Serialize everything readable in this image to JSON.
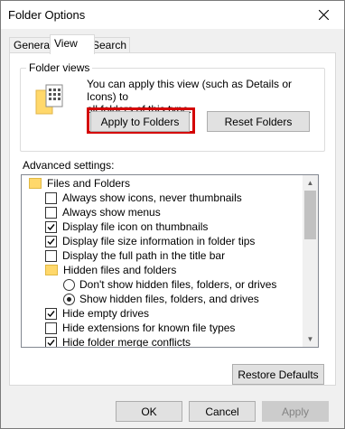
{
  "window": {
    "title": "Folder Options",
    "close_icon": "close-icon"
  },
  "tabs": [
    {
      "label": "General"
    },
    {
      "label": "View"
    },
    {
      "label": "Search"
    }
  ],
  "folder_views": {
    "legend": "Folder views",
    "description_line1": "You can apply this view (such as Details or Icons) to",
    "description_line2": "all folders of this type.",
    "apply_button": "Apply to Folders",
    "reset_button": "Reset Folders"
  },
  "advanced": {
    "label": "Advanced settings:",
    "items": [
      {
        "type": "folder",
        "label": "Files and Folders",
        "level": 0
      },
      {
        "type": "checkbox",
        "label": "Always show icons, never thumbnails",
        "checked": false,
        "level": 1
      },
      {
        "type": "checkbox",
        "label": "Always show menus",
        "checked": false,
        "level": 1
      },
      {
        "type": "checkbox",
        "label": "Display file icon on thumbnails",
        "checked": true,
        "level": 1
      },
      {
        "type": "checkbox",
        "label": "Display file size information in folder tips",
        "checked": true,
        "level": 1
      },
      {
        "type": "checkbox",
        "label": "Display the full path in the title bar",
        "checked": false,
        "level": 1
      },
      {
        "type": "folder",
        "label": "Hidden files and folders",
        "level": 1
      },
      {
        "type": "radio",
        "label": "Don't show hidden files, folders, or drives",
        "checked": false,
        "level": 2
      },
      {
        "type": "radio",
        "label": "Show hidden files, folders, and drives",
        "checked": true,
        "level": 2
      },
      {
        "type": "checkbox",
        "label": "Hide empty drives",
        "checked": true,
        "level": 1
      },
      {
        "type": "checkbox",
        "label": "Hide extensions for known file types",
        "checked": false,
        "level": 1
      },
      {
        "type": "checkbox",
        "label": "Hide folder merge conflicts",
        "checked": true,
        "level": 1
      }
    ],
    "restore_button": "Restore Defaults"
  },
  "footer": {
    "ok": "OK",
    "cancel": "Cancel",
    "apply": "Apply"
  },
  "colors": {
    "highlight": "#d40000",
    "folder": "#ffd86b"
  }
}
